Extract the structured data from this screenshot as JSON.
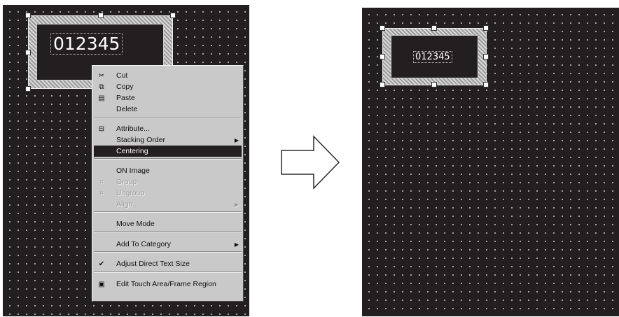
{
  "left_panel": {
    "part_text": "012345",
    "context_menu": {
      "items": [
        {
          "icon": "scissors-icon",
          "glyph": "✂",
          "label": "Cut",
          "state": "normal"
        },
        {
          "icon": "copy-icon",
          "glyph": "⧉",
          "label": "Copy",
          "state": "normal"
        },
        {
          "icon": "paste-icon",
          "glyph": "▤",
          "label": "Paste",
          "state": "normal"
        },
        {
          "icon": "",
          "glyph": "",
          "label": "Delete",
          "state": "normal"
        },
        {
          "icon": "attribute-icon",
          "glyph": "⊟",
          "label": "Attribute...",
          "state": "normal"
        },
        {
          "icon": "",
          "glyph": "",
          "label": "Stacking Order",
          "state": "normal",
          "submenu": true
        },
        {
          "icon": "",
          "glyph": "",
          "label": "Centering",
          "state": "highlighted"
        },
        {
          "icon": "",
          "glyph": "",
          "label": "ON Image",
          "state": "normal"
        },
        {
          "icon": "group-icon",
          "glyph": "⌗",
          "label": "Group",
          "state": "disabled"
        },
        {
          "icon": "ungroup-icon",
          "glyph": "⌗",
          "label": "Ungroup",
          "state": "disabled"
        },
        {
          "icon": "",
          "glyph": "",
          "label": "Align...",
          "state": "disabled",
          "submenu": true
        },
        {
          "icon": "",
          "glyph": "",
          "label": "Move Mode",
          "state": "normal"
        },
        {
          "icon": "",
          "glyph": "",
          "label": "Add To Category",
          "state": "normal",
          "submenu": true
        },
        {
          "icon": "checkmark-icon",
          "glyph": "✔",
          "label": "Adjust Direct Text Size",
          "state": "normal"
        },
        {
          "icon": "touch-area-icon",
          "glyph": "▣",
          "label": "Edit Touch Area/Frame Region",
          "state": "normal"
        }
      ]
    }
  },
  "arrow": {
    "icon": "right-arrow-icon"
  },
  "right_panel": {
    "part_text": "012345"
  }
}
